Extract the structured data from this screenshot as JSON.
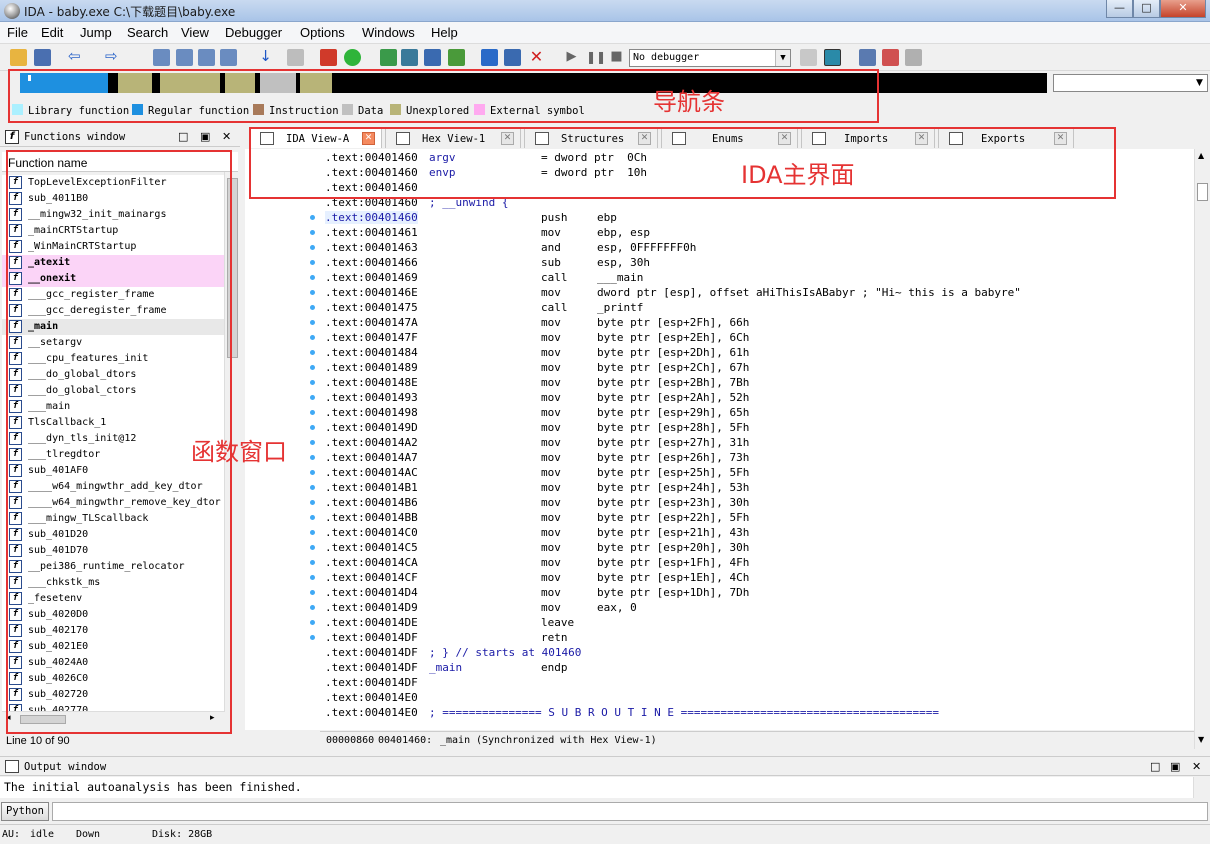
{
  "window": {
    "title": "IDA - baby.exe C:\\下载题目\\baby.exe",
    "minimize": "—",
    "maximize": "□",
    "close": "✕"
  },
  "menu": [
    "File",
    "Edit",
    "Jump",
    "Search",
    "View",
    "Debugger",
    "Options",
    "Windows",
    "Help"
  ],
  "debugger_select": "No debugger",
  "legend": [
    {
      "label": "Library function",
      "color": "#aaf0ff"
    },
    {
      "label": "Regular function",
      "color": "#1e90e0"
    },
    {
      "label": "Instruction",
      "color": "#a87a5a"
    },
    {
      "label": "Data",
      "color": "#c0c0c0"
    },
    {
      "label": "Unexplored",
      "color": "#b8b478"
    },
    {
      "label": "External symbol",
      "color": "#ffaaf0"
    }
  ],
  "annotations": {
    "nav": "导航条",
    "ida": "IDA主界面",
    "funcs": "函数窗口"
  },
  "functions_window": {
    "title": "Functions window",
    "column": "Function name",
    "items": [
      "TopLevelExceptionFilter",
      "sub_4011B0",
      "__mingw32_init_mainargs",
      "_mainCRTStartup",
      "_WinMainCRTStartup",
      "_atexit",
      "__onexit",
      "___gcc_register_frame",
      "___gcc_deregister_frame",
      "_main",
      "__setargv",
      "___cpu_features_init",
      "___do_global_dtors",
      "___do_global_ctors",
      "___main",
      "TlsCallback_1",
      "___dyn_tls_init@12",
      "___tlregdtor",
      "sub_401AF0",
      "____w64_mingwthr_add_key_dtor",
      "____w64_mingwthr_remove_key_dtor",
      "___mingw_TLScallback",
      "sub_401D20",
      "sub_401D70",
      "__pei386_runtime_relocator",
      "___chkstk_ms",
      "_fesetenv",
      "sub_4020D0",
      "sub_402170",
      "sub_4021E0",
      "sub_4024A0",
      "sub_4026C0",
      "sub_402720",
      "sub_402770"
    ],
    "line_info": "Line 10 of 90"
  },
  "tabs": [
    {
      "label": "IDA View-A",
      "active": true
    },
    {
      "label": "Hex View-1",
      "active": false
    },
    {
      "label": "Structures",
      "active": false
    },
    {
      "label": "Enums",
      "active": false
    },
    {
      "label": "Imports",
      "active": false
    },
    {
      "label": "Exports",
      "active": false
    }
  ],
  "code_lines": [
    {
      "addr": ".text:00401460",
      "label": "argv",
      "op": "= dword ptr  0Ch",
      "args": ""
    },
    {
      "addr": ".text:00401460",
      "label": "envp",
      "op": "= dword ptr  10h",
      "args": ""
    },
    {
      "addr": ".text:00401460",
      "label": "",
      "op": "",
      "args": ""
    },
    {
      "addr": ".text:00401460",
      "label": "; __unwind {",
      "op": "",
      "args": ""
    },
    {
      "addr": ".text:00401460",
      "label": "",
      "op": "push",
      "args": "ebp"
    },
    {
      "addr": ".text:00401461",
      "label": "",
      "op": "mov",
      "args": "ebp, esp"
    },
    {
      "addr": ".text:00401463",
      "label": "",
      "op": "and",
      "args": "esp, 0FFFFFFF0h"
    },
    {
      "addr": ".text:00401466",
      "label": "",
      "op": "sub",
      "args": "esp, 30h"
    },
    {
      "addr": ".text:00401469",
      "label": "",
      "op": "call",
      "args": "___main"
    },
    {
      "addr": ".text:0040146E",
      "label": "",
      "op": "mov",
      "args": "dword ptr [esp], offset aHiThisIsABabyr ; \"Hi~ this is a babyre\""
    },
    {
      "addr": ".text:00401475",
      "label": "",
      "op": "call",
      "args": "_printf"
    },
    {
      "addr": ".text:0040147A",
      "label": "",
      "op": "mov",
      "args": "byte ptr [esp+2Fh], 66h"
    },
    {
      "addr": ".text:0040147F",
      "label": "",
      "op": "mov",
      "args": "byte ptr [esp+2Eh], 6Ch"
    },
    {
      "addr": ".text:00401484",
      "label": "",
      "op": "mov",
      "args": "byte ptr [esp+2Dh], 61h"
    },
    {
      "addr": ".text:00401489",
      "label": "",
      "op": "mov",
      "args": "byte ptr [esp+2Ch], 67h"
    },
    {
      "addr": ".text:0040148E",
      "label": "",
      "op": "mov",
      "args": "byte ptr [esp+2Bh], 7Bh"
    },
    {
      "addr": ".text:00401493",
      "label": "",
      "op": "mov",
      "args": "byte ptr [esp+2Ah], 52h"
    },
    {
      "addr": ".text:00401498",
      "label": "",
      "op": "mov",
      "args": "byte ptr [esp+29h], 65h"
    },
    {
      "addr": ".text:0040149D",
      "label": "",
      "op": "mov",
      "args": "byte ptr [esp+28h], 5Fh"
    },
    {
      "addr": ".text:004014A2",
      "label": "",
      "op": "mov",
      "args": "byte ptr [esp+27h], 31h"
    },
    {
      "addr": ".text:004014A7",
      "label": "",
      "op": "mov",
      "args": "byte ptr [esp+26h], 73h"
    },
    {
      "addr": ".text:004014AC",
      "label": "",
      "op": "mov",
      "args": "byte ptr [esp+25h], 5Fh"
    },
    {
      "addr": ".text:004014B1",
      "label": "",
      "op": "mov",
      "args": "byte ptr [esp+24h], 53h"
    },
    {
      "addr": ".text:004014B6",
      "label": "",
      "op": "mov",
      "args": "byte ptr [esp+23h], 30h"
    },
    {
      "addr": ".text:004014BB",
      "label": "",
      "op": "mov",
      "args": "byte ptr [esp+22h], 5Fh"
    },
    {
      "addr": ".text:004014C0",
      "label": "",
      "op": "mov",
      "args": "byte ptr [esp+21h], 43h"
    },
    {
      "addr": ".text:004014C5",
      "label": "",
      "op": "mov",
      "args": "byte ptr [esp+20h], 30h"
    },
    {
      "addr": ".text:004014CA",
      "label": "",
      "op": "mov",
      "args": "byte ptr [esp+1Fh], 4Fh"
    },
    {
      "addr": ".text:004014CF",
      "label": "",
      "op": "mov",
      "args": "byte ptr [esp+1Eh], 4Ch"
    },
    {
      "addr": ".text:004014D4",
      "label": "",
      "op": "mov",
      "args": "byte ptr [esp+1Dh], 7Dh"
    },
    {
      "addr": ".text:004014D9",
      "label": "",
      "op": "mov",
      "args": "eax, 0"
    },
    {
      "addr": ".text:004014DE",
      "label": "",
      "op": "leave",
      "args": ""
    },
    {
      "addr": ".text:004014DF",
      "label": "",
      "op": "retn",
      "args": ""
    },
    {
      "addr": ".text:004014DF",
      "label": "; } // starts at 401460",
      "op": "",
      "args": ""
    },
    {
      "addr": ".text:004014DF",
      "label": "_main",
      "op": "endp",
      "args": ""
    },
    {
      "addr": ".text:004014DF",
      "label": "",
      "op": "",
      "args": ""
    },
    {
      "addr": ".text:004014E0",
      "label": "",
      "op": "",
      "args": ""
    },
    {
      "addr": ".text:004014E0",
      "label": "; =============== S U B R O U T I N E =======================================",
      "op": "",
      "args": ""
    }
  ],
  "status": {
    "offset": "00000860",
    "address": "00401460:",
    "func": "_main",
    "sync": "(Synchronized with Hex View-1)"
  },
  "output_window": {
    "title": "Output window",
    "text": "The initial autoanalysis has been finished."
  },
  "python_button": "Python",
  "bottom": {
    "au": "AU:",
    "state": "idle",
    "dir": "Down",
    "disk": "Disk: 28GB"
  }
}
